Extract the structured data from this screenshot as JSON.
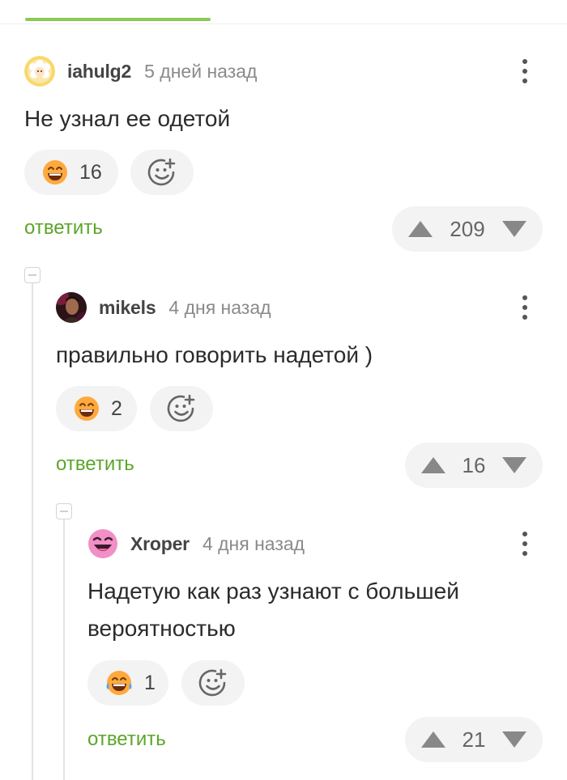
{
  "colors": {
    "accent_green": "#8ac858",
    "reply_green": "#5da52a",
    "pill_bg": "#f3f3f3"
  },
  "comments": [
    {
      "author": "iahulg2",
      "time": "5 дней назад",
      "lines": [
        "Не узнал ее одетой"
      ],
      "avatar_icon": "flower-avatar-icon",
      "reaction_icon": "grinning-emoji-icon",
      "reaction_count": "16",
      "reply_label": "ответить",
      "rating": "209"
    },
    {
      "author": "mikels",
      "time": "4 дня назад",
      "lines": [
        "правильно говорить надетой )"
      ],
      "avatar_icon": "photo-avatar-icon",
      "reaction_icon": "grinning-emoji-icon",
      "reaction_count": "2",
      "reply_label": "ответить",
      "rating": "16"
    },
    {
      "author": "Xroper",
      "time": "4 дня назад",
      "lines": [
        "Надетую как раз узнают с большей",
        "вероятностью"
      ],
      "avatar_icon": "smiling-face-avatar-icon",
      "reaction_icon": "tears-of-joy-emoji-icon",
      "reaction_count": "1",
      "reply_label": "ответить",
      "rating": "21"
    }
  ]
}
